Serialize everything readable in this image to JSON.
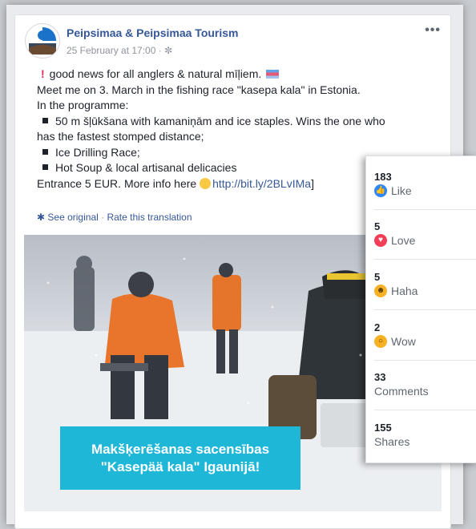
{
  "post": {
    "page_name": "Peipsimaa & Peipsimaa Tourism",
    "date": "25 February at 17:00",
    "privacy_glyph": "✼",
    "more_label": "•••",
    "lines": {
      "l1": "good news for all anglers & natural mīļiem.",
      "l2": "Meet me on 3. March in the fishing race \"kasepa kala\" in Estonia.",
      "l3": "In the programme:",
      "l4": "50 m šļūkšana with kamaniņām and ice staples. Wins the one who",
      "l5": "has the fastest stomped distance;",
      "l6": "Ice Drilling Race;",
      "l7": "Hot Soup & local artisanal delicacies",
      "l8_prefix": "Entrance 5 EUR. More info here",
      "l8_link": "http://bit.ly/2BLvIMa",
      "l8_suffix": "]"
    },
    "see_original": "See original",
    "separator": "·",
    "rate_translation": "Rate this translation",
    "banner": {
      "line1": "Makšķerēšanas sacensības",
      "line2": "\"Kasepää kala\" Igaunijā!"
    }
  },
  "reactions": {
    "like": {
      "count": "183",
      "label": "Like",
      "icon": "thumbs-up-icon",
      "color": "#2d88ff"
    },
    "love": {
      "count": "5",
      "label": "Love",
      "icon": "heart-icon",
      "color": "#f33e58"
    },
    "haha": {
      "count": "5",
      "label": "Haha",
      "icon": "laughing-face-icon",
      "color": "#f7b125"
    },
    "wow": {
      "count": "2",
      "label": "Wow",
      "icon": "surprised-face-icon",
      "color": "#f7b125"
    },
    "comments": {
      "count": "33",
      "label": "Comments"
    },
    "shares": {
      "count": "155",
      "label": "Shares"
    }
  }
}
